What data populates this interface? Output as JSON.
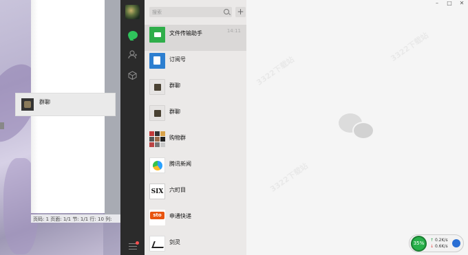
{
  "document": {
    "status_bar": "页码: 1  页面: 1/1  节: 1/1  行: 10  列:"
  },
  "drag_ghost": {
    "label": "群聊"
  },
  "search": {
    "placeholder": "搜索"
  },
  "add_button": "+",
  "chats": [
    {
      "name": "文件传输助手",
      "time": "14:11",
      "avatar": "file-transfer-icon"
    },
    {
      "name": "订阅号",
      "time": "",
      "avatar": "subscription-icon"
    },
    {
      "name": "群聊",
      "time": "",
      "avatar": "group-avatar"
    },
    {
      "name": "群聊",
      "time": "",
      "avatar": "group-avatar"
    },
    {
      "name": "购物群",
      "time": "",
      "avatar": "shopping-group-avatar"
    },
    {
      "name": "腾讯新闻",
      "time": "",
      "avatar": "tencent-news-icon"
    },
    {
      "name": "六町目",
      "time": "",
      "avatar": "six-logo"
    },
    {
      "name": "申通快递",
      "time": "",
      "avatar": "sto-logo"
    },
    {
      "name": "剑灵",
      "time": "",
      "avatar": "sword-logo"
    }
  ],
  "six_logo_text": "SIX",
  "sto_logo_text": "sto",
  "window_controls": {
    "minimize": "–",
    "maximize": "□",
    "close": "✕"
  },
  "netmon": {
    "percent": "35%",
    "up": "0.2K/s",
    "down": "0.6K/s"
  },
  "watermark": "3322下载站",
  "colors": {
    "accent_green": "#2fc25b",
    "nav_bg": "#2b2b2b",
    "list_bg": "#ebe9e8"
  }
}
